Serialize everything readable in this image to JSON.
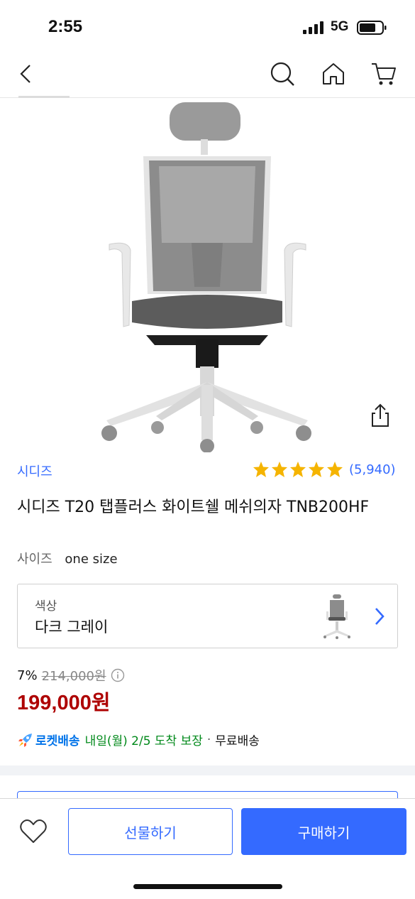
{
  "status_bar": {
    "time": "2:55",
    "network": "5G"
  },
  "nav": {
    "icons": [
      "back-icon",
      "search-icon",
      "home-icon",
      "cart-icon"
    ]
  },
  "product": {
    "brand": "시디즈",
    "rating_stars": 5,
    "review_count": "(5,940)",
    "title": "시디즈 T20 탭플러스 화이트쉘 메쉬의자 TNB200HF",
    "size_label": "사이즈",
    "size_value": "one size",
    "option": {
      "label": "색상",
      "value": "다크 그레이"
    },
    "discount_rate": "7%",
    "original_price": "214,000원",
    "sale_price": "199,000원",
    "delivery": {
      "rocket_label": "로켓배송",
      "date": "내일(월) 2/5 도착 보장",
      "separator": "·",
      "free_shipping": "무료배송"
    }
  },
  "bottom_bar": {
    "gift_label": "선물하기",
    "buy_label": "구매하기"
  },
  "colors": {
    "accent": "#346aff",
    "price": "#ae0000",
    "rocket": "#0073e9",
    "delivery_date": "#00891a",
    "star": "#f5b400"
  }
}
